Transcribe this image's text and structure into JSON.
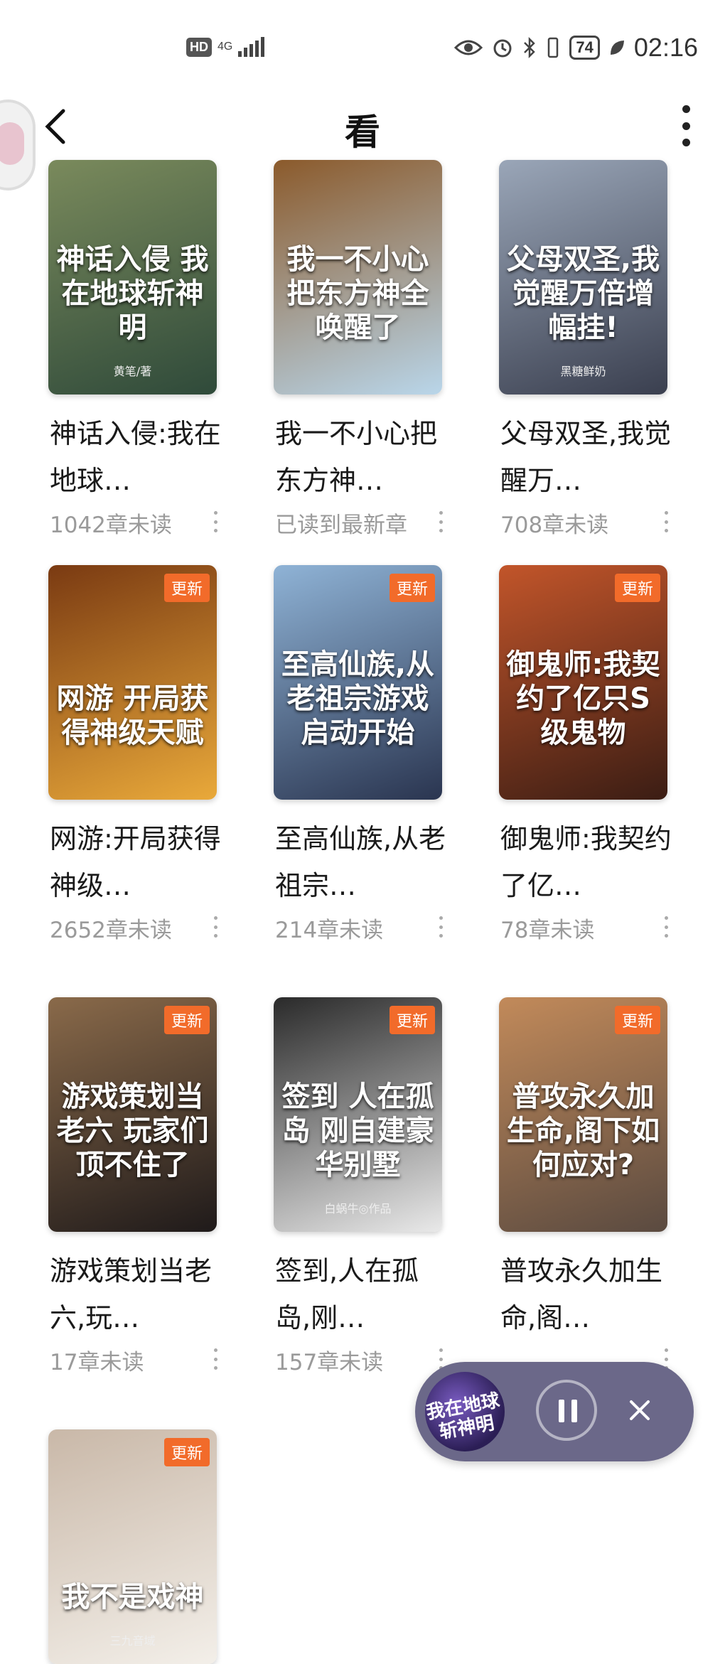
{
  "status_bar": {
    "hd": "HD",
    "network": "4G",
    "battery": "74",
    "time": "02:16"
  },
  "header": {
    "title": "看"
  },
  "books": [
    {
      "cover_title": "神话入侵 我在地球斩神明",
      "cover_author": "黄笔/著",
      "name": "神话入侵:我在地球…",
      "status": "1042章未读",
      "badge": "",
      "colors": [
        "#2f4a3a",
        "#7a8a5c"
      ]
    },
    {
      "cover_title": "我一不小心把东方神全唤醒了",
      "cover_author": "",
      "name": "我一不小心把东方神…",
      "status": "已读到最新章",
      "badge": "",
      "colors": [
        "#b9d6ea",
        "#8b5a2b"
      ]
    },
    {
      "cover_title": "父母双圣,我觉醒万倍增幅挂!",
      "cover_author": "黑糖鲜奶",
      "name": "父母双圣,我觉醒万…",
      "status": "708章未读",
      "badge": "",
      "colors": [
        "#3a3f4f",
        "#9aa6b8"
      ]
    },
    {
      "cover_title": "网游 开局获得神级天赋",
      "cover_author": "",
      "name": "网游:开局获得神级…",
      "status": "2652章未读",
      "badge": "更新",
      "colors": [
        "#e9a93a",
        "#7a3a12"
      ]
    },
    {
      "cover_title": "至高仙族,从老祖宗游戏启动开始",
      "cover_author": "",
      "name": "至高仙族,从老祖宗…",
      "status": "214章未读",
      "badge": "更新",
      "colors": [
        "#2a3550",
        "#8fb3d6"
      ]
    },
    {
      "cover_title": "御鬼师:我契约了亿只S级鬼物",
      "cover_author": "",
      "name": "御鬼师:我契约了亿…",
      "status": "78章未读",
      "badge": "更新",
      "colors": [
        "#3b1d14",
        "#c2552a"
      ]
    },
    {
      "cover_title": "游戏策划当老六 玩家们顶不住了",
      "cover_author": "",
      "name": "游戏策划当老六,玩…",
      "status": "17章未读",
      "badge": "更新",
      "colors": [
        "#1f1a1a",
        "#8a6a4a"
      ]
    },
    {
      "cover_title": "签到 人在孤岛 刚自建豪华别墅",
      "cover_author": "白蜗牛◎作品",
      "name": "签到,人在孤岛,刚…",
      "status": "157章未读",
      "badge": "更新",
      "colors": [
        "#e9e9e9",
        "#2a2a2a"
      ]
    },
    {
      "cover_title": "普攻永久加生命,阁下如何应对?",
      "cover_author": "",
      "name": "普攻永久加生命,阁…",
      "status": "",
      "badge": "更新",
      "colors": [
        "#5a4a40",
        "#c28a5a"
      ]
    },
    {
      "cover_title": "我不是戏神",
      "cover_author": "三九音域",
      "name": "",
      "status": "",
      "badge": "更新",
      "colors": [
        "#f3efe9",
        "#c9b8a8"
      ]
    }
  ],
  "player": {
    "thumb_text": "我在地球斩神明"
  }
}
